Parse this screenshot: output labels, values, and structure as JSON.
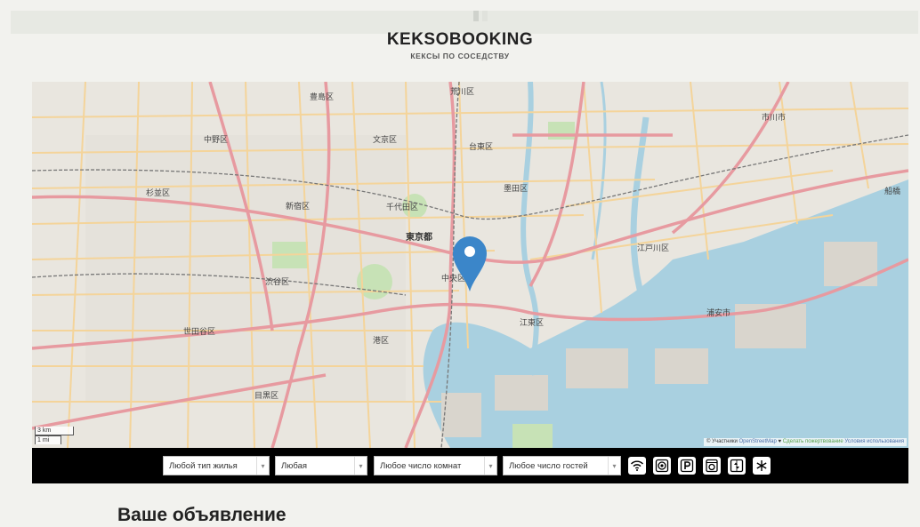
{
  "header": {
    "logo": "KEKSOBOOKING",
    "tagline": "КЕКСЫ ПО СОСЕДСТВУ"
  },
  "map": {
    "labels": [
      "豊島区",
      "荒川区",
      "中野区",
      "文京区",
      "台東区",
      "市川市",
      "杉並区",
      "墨田区",
      "新宿区",
      "千代田区",
      "東京都",
      "江戸川区",
      "中央区",
      "渋谷区",
      "江東区",
      "浦安市",
      "世田谷区",
      "港区",
      "目黒区",
      "船橋"
    ],
    "scale_km": "3 km",
    "scale_mi": "1 mi",
    "attribution_prefix": "© Участники",
    "attribution_osm": "OpenStreetMap",
    "attribution_heart": "♥",
    "attribution_fix": "Сделать пожертвование",
    "attribution_terms": "Условия использования",
    "colors": {
      "land": "#e9e6df",
      "water": "#a9d0e0",
      "park": "#c7e2b6",
      "primary_road": "#e79aa0",
      "secondary_road": "#f4d49a",
      "pin": "#3b86c9"
    }
  },
  "filters": {
    "housing_type": "Любой тип жилья",
    "price": "Любая",
    "rooms": "Любое число комнат",
    "guests": "Любое число гостей",
    "features": [
      "wifi-icon",
      "dishwasher-icon",
      "parking-icon",
      "washer-icon",
      "elevator-icon",
      "conditioner-icon"
    ]
  },
  "notice": {
    "title": "Ваше объявление"
  }
}
